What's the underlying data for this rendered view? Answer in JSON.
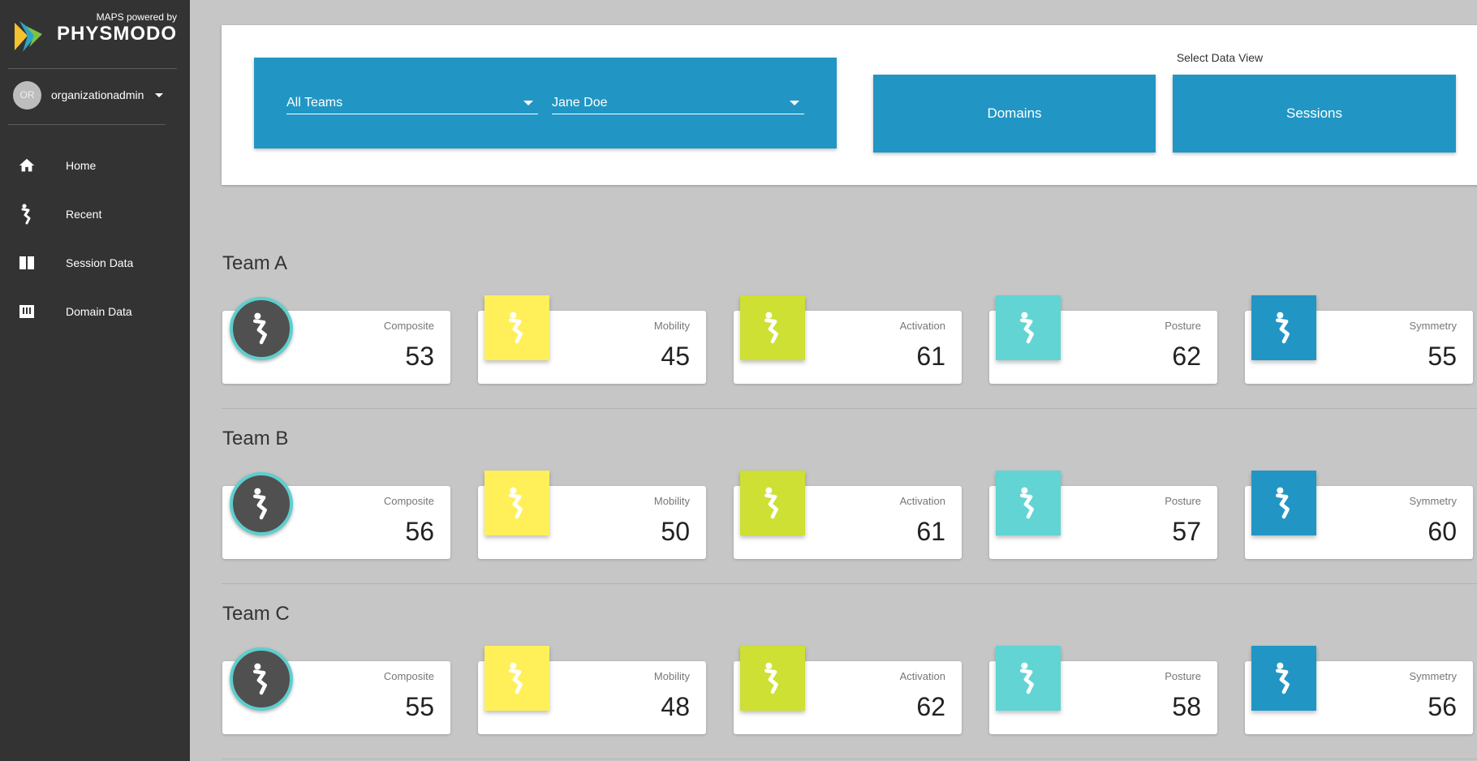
{
  "brand": {
    "powered_by": "MAPS powered by",
    "name": "PHYSMODO"
  },
  "user": {
    "initials": "OR",
    "name": "organizationadmin"
  },
  "nav": [
    {
      "label": "Home",
      "icon": "home-icon"
    },
    {
      "label": "Recent",
      "icon": "figure-icon"
    },
    {
      "label": "Session Data",
      "icon": "columns-icon"
    },
    {
      "label": "Domain Data",
      "icon": "chart-icon"
    }
  ],
  "filters": {
    "team": "All Teams",
    "athlete": "Jane Doe"
  },
  "data_view": {
    "label": "Select Data View",
    "buttons": [
      "Domains",
      "Sessions"
    ]
  },
  "colors": {
    "accent": "#2196c4",
    "composite": "#505050",
    "composite_ring": "#5dcfcd",
    "mobility": "#fff05a",
    "activation": "#cde033",
    "posture": "#62d4d4",
    "symmetry": "#2196c4"
  },
  "teams": [
    {
      "name": "Team A",
      "metrics": [
        {
          "label": "Composite",
          "value": "53"
        },
        {
          "label": "Mobility",
          "value": "45"
        },
        {
          "label": "Activation",
          "value": "61"
        },
        {
          "label": "Posture",
          "value": "62"
        },
        {
          "label": "Symmetry",
          "value": "55"
        }
      ]
    },
    {
      "name": "Team B",
      "metrics": [
        {
          "label": "Composite",
          "value": "56"
        },
        {
          "label": "Mobility",
          "value": "50"
        },
        {
          "label": "Activation",
          "value": "61"
        },
        {
          "label": "Posture",
          "value": "57"
        },
        {
          "label": "Symmetry",
          "value": "60"
        }
      ]
    },
    {
      "name": "Team C",
      "metrics": [
        {
          "label": "Composite",
          "value": "55"
        },
        {
          "label": "Mobility",
          "value": "48"
        },
        {
          "label": "Activation",
          "value": "62"
        },
        {
          "label": "Posture",
          "value": "58"
        },
        {
          "label": "Symmetry",
          "value": "56"
        }
      ]
    }
  ]
}
